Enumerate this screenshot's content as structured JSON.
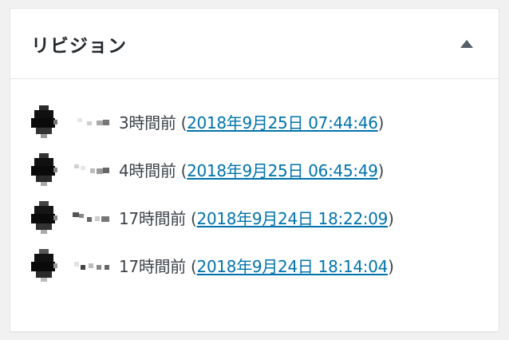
{
  "box": {
    "title": "リビジョン",
    "toggle_icon": "triangle-up-icon"
  },
  "colors": {
    "link": "#0073aa",
    "text": "#3c434a",
    "border": "#e2e4e7"
  },
  "revisions": [
    {
      "author": "(pixelated)",
      "ago": "3時間前",
      "open_paren": "(",
      "date": "2018年9月25日 07:44:46",
      "close_paren": ")"
    },
    {
      "author": "(pixelated)",
      "ago": "4時間前",
      "open_paren": "(",
      "date": "2018年9月25日 06:45:49",
      "close_paren": ")"
    },
    {
      "author": "(pixelated)",
      "ago": "17時間前",
      "open_paren": "(",
      "date": "2018年9月24日 18:22:09",
      "close_paren": ")"
    },
    {
      "author": "(pixelated)",
      "ago": "17時間前",
      "open_paren": "(",
      "date": "2018年9月24日 18:14:04",
      "close_paren": ")"
    }
  ]
}
